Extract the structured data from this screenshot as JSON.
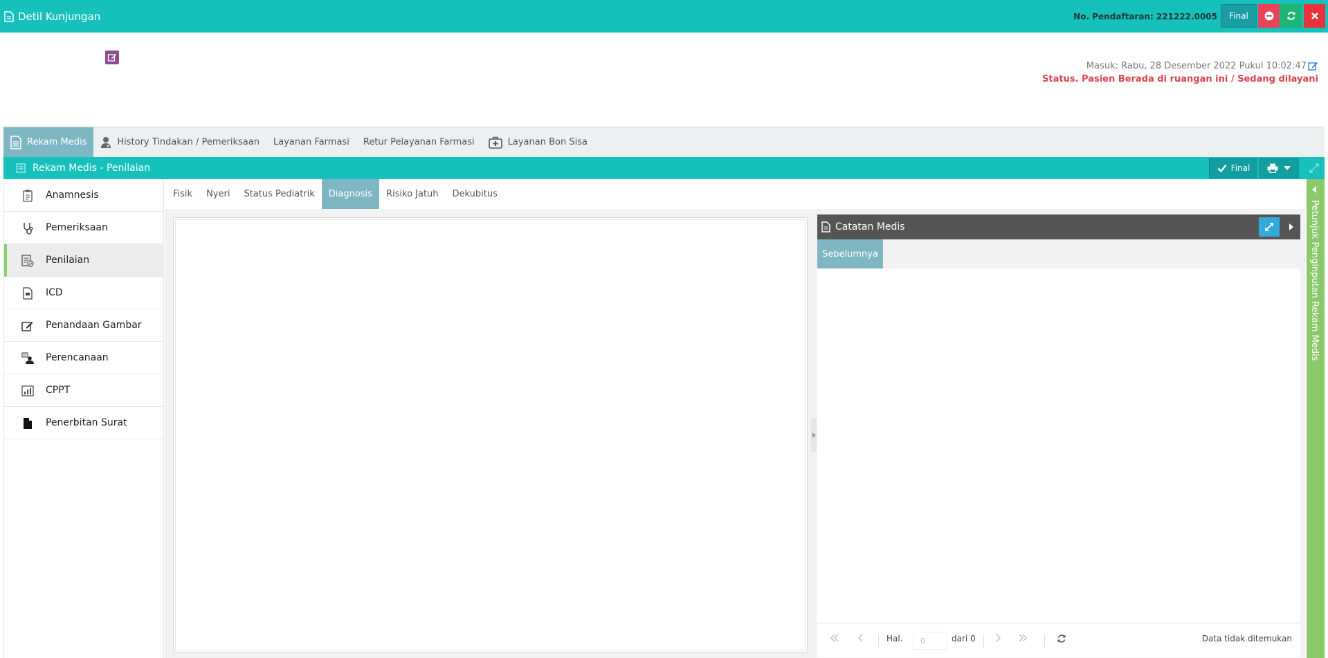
{
  "topbar": {
    "title": "Detil Kunjungan",
    "registration": "No. Pendaftaran: 221222.0005",
    "final_label": "Final",
    "colors": {
      "bg": "#17c1bb",
      "minus": "#e84357",
      "refresh": "#1db575",
      "close": "#e8323c"
    }
  },
  "header": {
    "masuk": "Masuk: Rabu, 28 Desember 2022 Pukul 10:02:47",
    "status": "Status. Pasien Berada di ruangan ini / Sedang dilayani"
  },
  "main_tabs": [
    {
      "label": "Rekam Medis",
      "icon": "document-icon"
    },
    {
      "label": "History Tindakan / Pemeriksaan",
      "icon": "doctor-icon"
    },
    {
      "label": "Layanan Farmasi",
      "icon": ""
    },
    {
      "label": "Retur Pelayanan Farmasi",
      "icon": ""
    },
    {
      "label": "Layanan Bon Sisa",
      "icon": "medical-kit-icon"
    }
  ],
  "panel": {
    "title": "Rekam Medis - Penilaian",
    "final_label": "Final"
  },
  "sidebar": {
    "items": [
      {
        "label": "Anamnesis",
        "icon": "clipboard-icon"
      },
      {
        "label": "Pemeriksaan",
        "icon": "stethoscope-icon"
      },
      {
        "label": "Penilaian",
        "icon": "assessment-icon"
      },
      {
        "label": "ICD",
        "icon": "file-code-icon"
      },
      {
        "label": "Penandaan Gambar",
        "icon": "edit-icon"
      },
      {
        "label": "Perencanaan",
        "icon": "planning-icon"
      },
      {
        "label": "CPPT",
        "icon": "chart-icon"
      },
      {
        "label": "Penerbitan Surat",
        "icon": "file-icon"
      }
    ]
  },
  "sub_tabs": [
    "Fisik",
    "Nyeri",
    "Status Pediatrik",
    "Diagnosis",
    "Risiko Jatuh",
    "Dekubitus"
  ],
  "catatan": {
    "title": "Catatan Medis",
    "tab_label": "Sebelumnya",
    "pager": {
      "hal_label": "Hal.",
      "page_value": "0",
      "of_label": "dari 0",
      "empty_message": "Data tidak ditemukan"
    }
  },
  "side_panel": {
    "label": "Petunjuk Penginputan Rekam Medis"
  }
}
